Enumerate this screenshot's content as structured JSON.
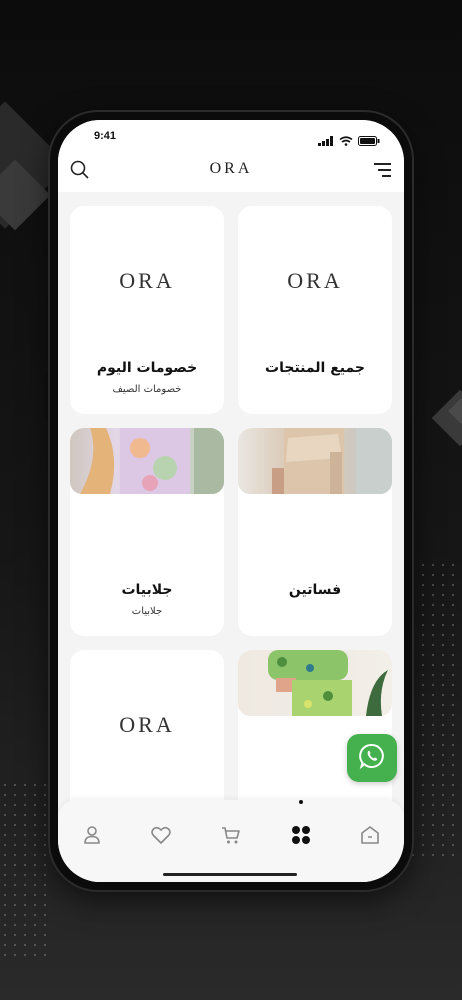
{
  "status_bar": {
    "time": "9:41"
  },
  "app_bar": {
    "brand": "ORA",
    "icons": {
      "search": "search-icon",
      "menu": "menu-icon"
    }
  },
  "categories": [
    {
      "title": "جميع المنتجات",
      "subtitle": "",
      "logo": "ORA",
      "has_photo": false
    },
    {
      "title": "خصومات اليوم",
      "subtitle": "خصومات الصيف",
      "logo": "ORA",
      "has_photo": false
    },
    {
      "title": "فساتين",
      "subtitle": "",
      "has_photo": true
    },
    {
      "title": "جلابيات",
      "subtitle": "جلابيات",
      "has_photo": true
    },
    {
      "title": "",
      "subtitle": "",
      "has_photo": true
    },
    {
      "title": "",
      "subtitle": "",
      "logo": "ORA",
      "has_photo": false
    }
  ],
  "floating_button": {
    "icon": "whatsapp-icon",
    "color": "#44b04e"
  },
  "bottom_nav": {
    "items": [
      {
        "icon": "home-icon",
        "active": false
      },
      {
        "icon": "categories-icon",
        "active": true
      },
      {
        "icon": "cart-icon",
        "active": false
      },
      {
        "icon": "heart-icon",
        "active": false
      },
      {
        "icon": "profile-icon",
        "active": false
      }
    ]
  },
  "colors": {
    "background": "#111111",
    "screen": "#f4f4f4",
    "card": "#ffffff",
    "accent": "#44b04e"
  }
}
